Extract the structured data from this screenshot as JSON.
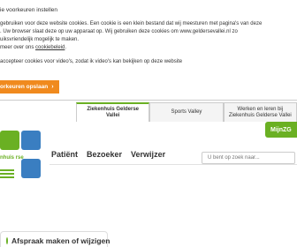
{
  "cookie": {
    "title": "ie voorkeuren instellen",
    "paragraph_lines": [
      "gebruiken voor deze website cookies. Een cookie is een klein bestand dat wij meesturen met pagina's van deze",
      ". Uw browser slaat deze op uw apparaat op. Wij gebruiken deze cookies om www.geldersevallei.nl zo",
      "uiksvriendelijk mogelijk te maken.",
      "meer over ons "
    ],
    "link_label": "cookiebeleid",
    "link_suffix": ".",
    "option_text": "accepteer cookies voor video's, zodat ik video's kan bekijken op deze website",
    "save_label": "orkeuren opslaan",
    "save_icon": "chevron-right-icon"
  },
  "site": {
    "tabs": [
      {
        "label": "Ziekenhuis Gelderse Vallei"
      },
      {
        "label": "Sports Valley"
      },
      {
        "label": "Werken en leren bij Ziekenhuis Gelderse Vallei"
      }
    ],
    "account_label": "MijnZG",
    "logo_text": "nhuis rse",
    "nav": [
      "Patiënt",
      "Bezoeker",
      "Verwijzer"
    ],
    "search_placeholder": "U bent op zoek naar...",
    "appointment_label": "Afspraak maken of wijzigen"
  },
  "colors": {
    "brand_green": "#6ab023",
    "brand_blue": "#3a7ec1",
    "button_orange": "#f08a1e"
  }
}
